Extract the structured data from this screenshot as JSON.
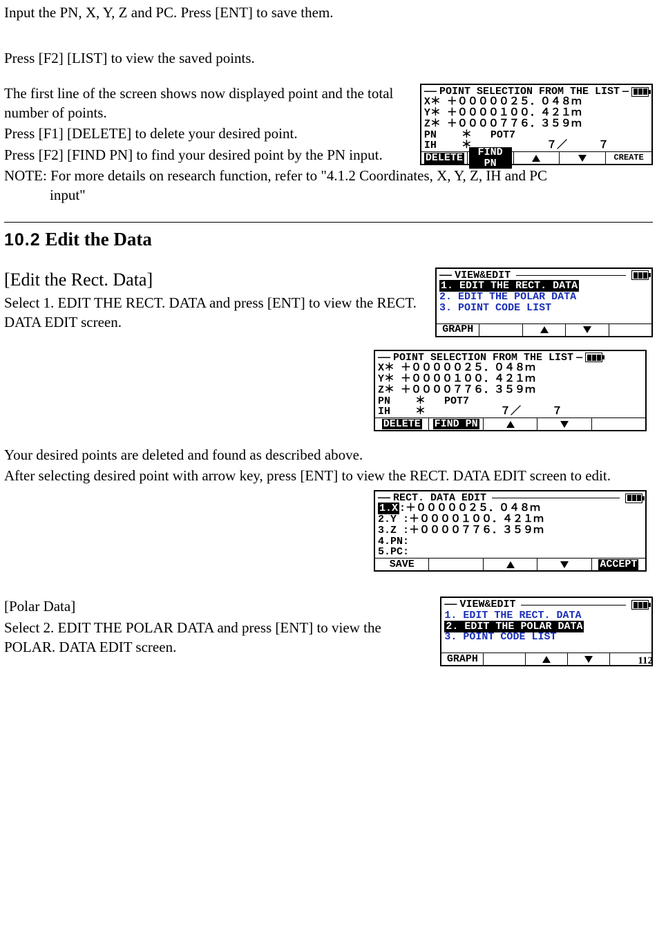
{
  "para1": "Input the PN, X, Y, Z and PC. Press [ENT] to save them.",
  "para2": "Press [F2] [LIST] to view the saved points.",
  "para3a": "The first line of the screen shows now displayed point and the total number of points.",
  "para3b": "Press [F1] [DELETE] to delete your desired point.",
  "para3c": "Press [F2] [FIND PN] to find your desired point by the PN input.",
  "note_lead": "NOTE: For more details on research function, refer to \"4.1.2 Coordinates, X, Y, Z, IH and PC",
  "note_indent": "input\"",
  "section_num": "10.2",
  "section_title": " Edit the Data",
  "sub1": "[Edit the Rect. Data]",
  "sub1_p": "Select 1. EDIT THE RECT. DATA and press [ENT] to view the RECT. DATA EDIT screen.",
  "para_mid1": "Your desired points are deleted and found as described above.",
  "para_mid2": "After selecting desired point with arrow key, press [ENT] to view the RECT. DATA EDIT screen to edit.",
  "sub2": "[Polar Data]",
  "sub2_p": "Select 2. EDIT THE POLAR DATA and press [ENT] to view the POLAR. DATA EDIT screen.",
  "page_number": "112",
  "lcd_pointsel": {
    "title": "POINT SELECTION FROM THE LIST",
    "x": "X＊ ＋０００００２５．０４８ｍ",
    "y": "Y＊ ＋００００１００．４２１ｍ",
    "z": "Z＊ ＋００００７７６．３５９ｍ",
    "pn": "PN    ＊   POT7",
    "ih": "IH    ＊            ７／     ７",
    "menu": {
      "f1": "DELETE",
      "f2": "FIND PN",
      "f5": "CREATE"
    }
  },
  "lcd_pointsel2": {
    "title": "POINT SELECTION FROM THE LIST",
    "x": "X＊ ＋０００００２５．０４８ｍ",
    "y": "Y＊ ＋００００１００．４２１ｍ",
    "z": "Z＊ ＋００００７７６．３５９ｍ",
    "pn": "PN    ＊   POT7",
    "ih": "IH    ＊            ７／     ７",
    "menu": {
      "f1": "DELETE",
      "f2": "FIND PN"
    }
  },
  "lcd_viewedit1": {
    "title": "VIEW&EDIT",
    "item1": "1. EDIT THE RECT. DATA",
    "item2": "2. EDIT THE POLAR DATA",
    "item3": "3. POINT CODE LIST",
    "menu": {
      "f1": "GRAPH"
    }
  },
  "lcd_rectedit": {
    "title": "RECT. DATA EDIT",
    "l1_label": "1.X",
    "l1": ":＋０００００２５．０４８ｍ",
    "l2": "2.Y :＋００００１００．４２１ｍ",
    "l3": "3.Z :＋００００７７６．３５９ｍ",
    "l4": "4.PN:",
    "l5": "5.PC:",
    "menu": {
      "f1": "SAVE",
      "f5": "ACCEPT"
    }
  },
  "lcd_viewedit2": {
    "title": "VIEW&EDIT",
    "item1": "1. EDIT THE RECT. DATA",
    "item2": "2. EDIT THE POLAR DATA",
    "item3": "3. POINT CODE LIST",
    "menu": {
      "f1": "GRAPH"
    }
  }
}
